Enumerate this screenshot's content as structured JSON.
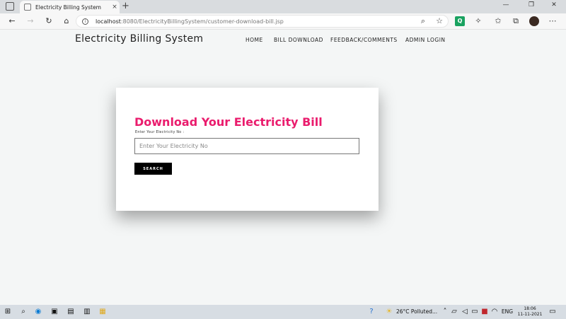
{
  "browser": {
    "tab_title": "Electricity Billing System",
    "tab_close": "×",
    "new_tab": "+",
    "url_host": "localhost",
    "url_path": ":8080/ElectricityBillingSystem/customer-download-bill.jsp",
    "window_controls": [
      "—",
      "❐",
      "✕"
    ]
  },
  "site": {
    "brand": "Electricity Billing System",
    "nav": [
      "HOME",
      "BILL DOWNLOAD",
      "FEEDBACK/COMMENTS",
      "ADMIN LOGIN"
    ]
  },
  "form": {
    "title": "Download Your Electricity Bill",
    "label": "Enter Your Electricity No :",
    "placeholder": "Enter Your Electricity No",
    "value": "",
    "button": "SEARCH"
  },
  "taskbar": {
    "weather": "26°C  Polluted...",
    "lang": "ENG",
    "time": "18:06",
    "date": "11-11-2021"
  },
  "colors": {
    "accent_pink": "#ea1c6d",
    "button_bg": "#000000",
    "page_bg": "#f4f6f6"
  }
}
